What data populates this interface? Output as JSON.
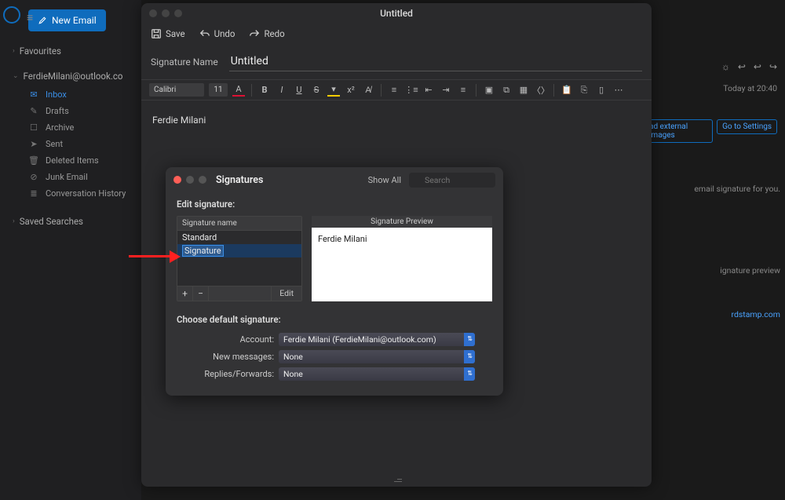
{
  "sidebar": {
    "new_email": "New Email",
    "favourites": "Favourites",
    "account": "FerdieMilani@outlook.co",
    "folders": [
      {
        "icon": "inbox",
        "label": "Inbox",
        "active": true
      },
      {
        "icon": "pencil",
        "label": "Drafts"
      },
      {
        "icon": "archive",
        "label": "Archive"
      },
      {
        "icon": "send",
        "label": "Sent"
      },
      {
        "icon": "trash",
        "label": "Deleted Items"
      },
      {
        "icon": "junk",
        "label": "Junk Email"
      },
      {
        "icon": "convo",
        "label": "Conversation History"
      }
    ],
    "saved_searches": "Saved Searches"
  },
  "editor": {
    "window_title": "Untitled",
    "toolbar": {
      "save": "Save",
      "undo": "Undo",
      "redo": "Redo"
    },
    "sig_name_label": "Signature Name",
    "sig_name_value": "Untitled",
    "font_name": "Calibri",
    "font_size": "11",
    "body_text": "Ferdie Milani"
  },
  "modal": {
    "title": "Signatures",
    "show_all": "Show All",
    "search_placeholder": "Search",
    "edit_sig_label": "Edit signature:",
    "list_header": "Signature name",
    "rows": [
      "Standard",
      "Signature"
    ],
    "plus": "+",
    "minus": "−",
    "edit": "Edit",
    "preview_header": "Signature Preview",
    "preview_body": "Ferdie Milani",
    "defaults_header": "Choose default signature:",
    "account_label": "Account:",
    "account_value": "Ferdie Milani (FerdieMilani@outlook.com)",
    "newmsg_label": "New messages:",
    "newmsg_value": "None",
    "replies_label": "Replies/Forwards:",
    "replies_value": "None"
  },
  "right": {
    "time": "Today at 20:40",
    "btn1": "ad external images",
    "btn2": "Go to Settings",
    "txt1": "email signature for you.",
    "txt2": "ignature preview",
    "link": "rdstamp.com"
  }
}
